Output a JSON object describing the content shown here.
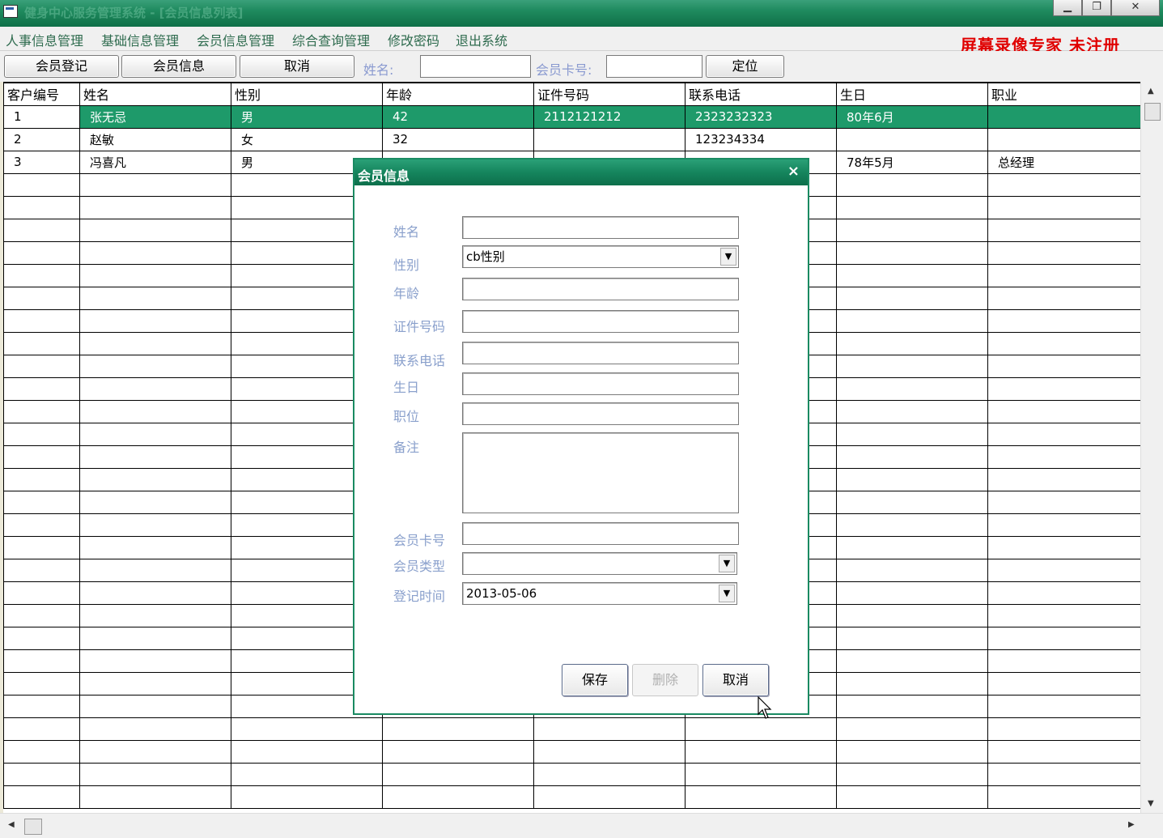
{
  "window": {
    "title": "健身中心服务管理系统 - [会员信息列表]"
  },
  "menu": [
    "人事信息管理",
    "基础信息管理",
    "会员信息管理",
    "综合查询管理",
    "修改密码",
    "退出系统"
  ],
  "watermark": "屏幕录像专家  未注册",
  "toolbar": {
    "register_label": "会员登记",
    "info_label": "会员信息",
    "cancel_label": "取消",
    "name_label": "姓名:",
    "card_label": "会员卡号:",
    "locate_label": "定位"
  },
  "grid": {
    "columns": [
      "客户编号",
      "姓名",
      "性别",
      "年龄",
      "证件号码",
      "联系电话",
      "生日",
      "职业"
    ],
    "rows": [
      [
        "1",
        "张无忌",
        "男",
        "42",
        "2112121212",
        "2323232323",
        "80年6月",
        ""
      ],
      [
        "2",
        "赵敏",
        "女",
        "32",
        "",
        "123234334",
        "",
        ""
      ],
      [
        "3",
        "冯喜凡",
        "男",
        "",
        "",
        "",
        "78年5月",
        "总经理"
      ]
    ],
    "selected_row": 0,
    "accent": "#1e9a6a"
  },
  "dialog": {
    "title": "会员信息",
    "close": "×",
    "labels": {
      "name": "姓名",
      "gender": "性别",
      "age": "年龄",
      "id": "证件号码",
      "phone": "联系电话",
      "birthday": "生日",
      "position": "职位",
      "note": "备注",
      "card": "会员卡号",
      "type": "会员类型",
      "regtime": "登记时间"
    },
    "values": {
      "gender": "cb性别",
      "regtime": "2013-05-06"
    },
    "buttons": {
      "save": "保存",
      "delete": "删除",
      "cancel": "取消"
    }
  },
  "colors": {
    "title_green": "#15855d",
    "label_blue": "#8aa0cc",
    "watermark_red": "#e00000"
  },
  "icons": [
    "app-icon",
    "minimize-icon",
    "restore-icon",
    "close-icon",
    "chevron-down-icon",
    "cursor-icon"
  ]
}
